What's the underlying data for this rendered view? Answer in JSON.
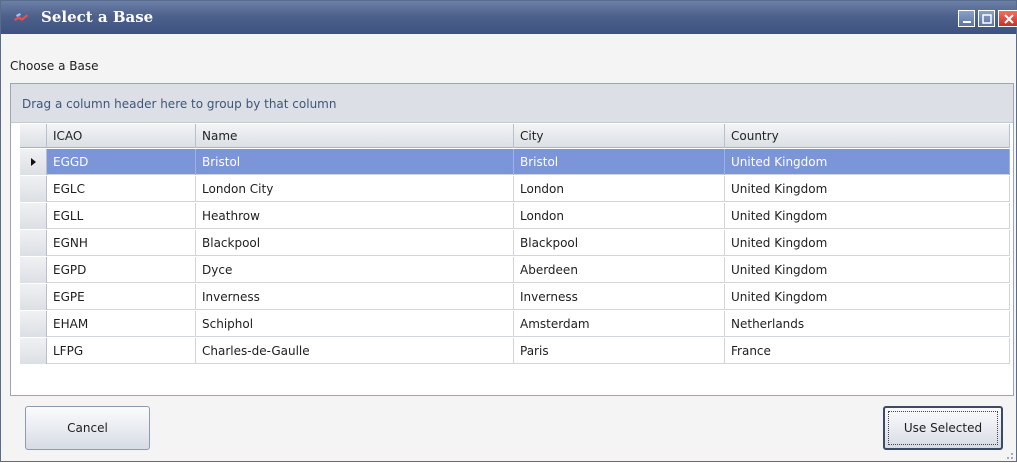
{
  "window": {
    "title": "Select a Base",
    "colors": {
      "titlebar": "#4d618c",
      "selected_row": "#7b95d8",
      "group_text": "#3e5779"
    }
  },
  "prompt_label": "Choose a Base",
  "grid": {
    "group_hint": "Drag a column header here to group by that column",
    "columns": [
      "ICAO",
      "Name",
      "City",
      "Country"
    ],
    "selected_index": 0,
    "rows": [
      {
        "icao": "EGGD",
        "name": "Bristol",
        "city": "Bristol",
        "country": "United Kingdom"
      },
      {
        "icao": "EGLC",
        "name": "London City",
        "city": "London",
        "country": "United Kingdom"
      },
      {
        "icao": "EGLL",
        "name": "Heathrow",
        "city": "London",
        "country": "United Kingdom"
      },
      {
        "icao": "EGNH",
        "name": "Blackpool",
        "city": "Blackpool",
        "country": "United Kingdom"
      },
      {
        "icao": "EGPD",
        "name": "Dyce",
        "city": "Aberdeen",
        "country": "United Kingdom"
      },
      {
        "icao": "EGPE",
        "name": "Inverness",
        "city": "Inverness",
        "country": "United Kingdom"
      },
      {
        "icao": "EHAM",
        "name": "Schiphol",
        "city": "Amsterdam",
        "country": "Netherlands"
      },
      {
        "icao": "LFPG",
        "name": "Charles-de-Gaulle",
        "city": "Paris",
        "country": "France"
      }
    ]
  },
  "buttons": {
    "cancel": "Cancel",
    "use_selected": "Use Selected"
  },
  "icons": {
    "app": "app-icon",
    "minimize": "minimize-icon",
    "maximize": "maximize-icon",
    "close": "close-icon",
    "row_indicator": "row-indicator-arrow-icon",
    "resize": "resize-grip-icon"
  }
}
